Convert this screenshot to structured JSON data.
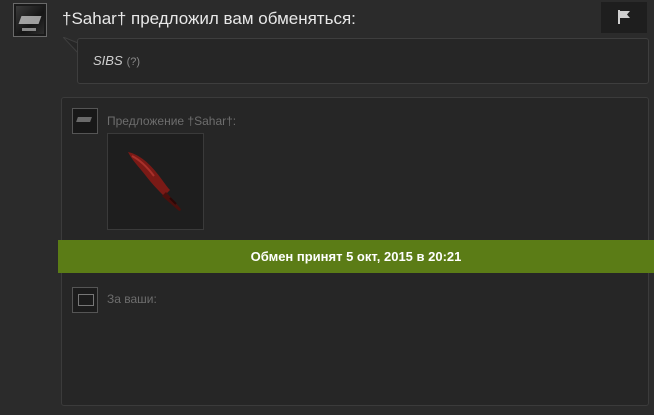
{
  "sender": {
    "name": "†Sahar†",
    "headline": "†Sahar† предложил вам обменяться:"
  },
  "message": {
    "text": "SIBS",
    "help": "(?)"
  },
  "offer": {
    "their_label": "Предложение †Sahar†:",
    "your_label": "За ваши:",
    "items": [
      {
        "icon": "gut-knife-icon"
      }
    ]
  },
  "status": {
    "text": "Обмен принят 5 окт, 2015 в 20:21",
    "color": "#5b7c16"
  },
  "colors": {
    "background": "#2b2b2b",
    "panel": "#262626",
    "accent": "#5b7c16"
  }
}
